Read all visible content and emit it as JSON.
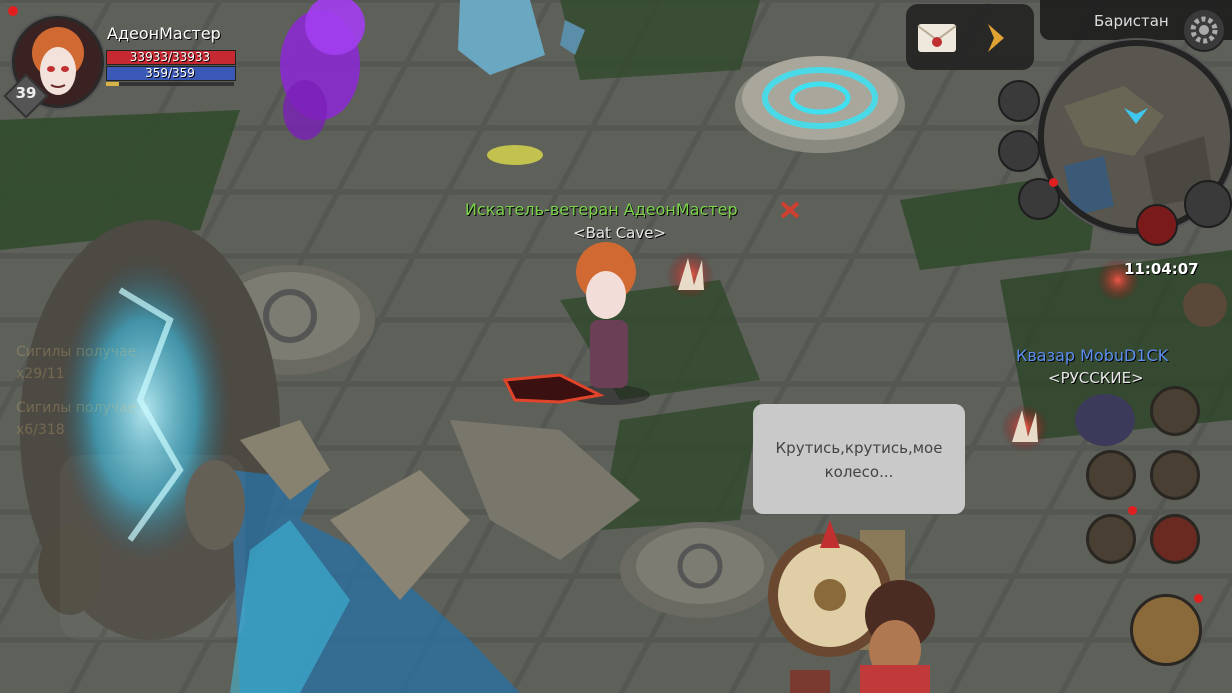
{
  "player": {
    "name": "АдеонМастер",
    "level": "39",
    "hp_text": "33933/33933",
    "mp_text": "359/359",
    "xp_fraction": 0.1
  },
  "location": {
    "name": "Баристан"
  },
  "clock": "11:04:07",
  "world": {
    "player_title": "Искатель-ветеран",
    "player_name": "АдеонМастер",
    "player_guild": "<Bat Cave>",
    "other_title": "Квазар",
    "other_name": "MobuD1CK",
    "other_guild": "<РУССКИЕ>"
  },
  "speech": {
    "text": "Крутись,крутись,мое колесо..."
  },
  "chat": {
    "line1": "Сигилы получае",
    "line1b": "x29/11",
    "line2": "Сигилы получае",
    "line2b": "x6/318"
  },
  "colors": {
    "hp": "#c62931",
    "mp": "#3a58b6",
    "player_name": "#7bd34a",
    "other_name": "#5c8ff0",
    "portal": "#4fd0f0"
  },
  "icons": {
    "mail": "envelope-icon",
    "expand": "chevron-right-icon",
    "settings": "gear-icon"
  }
}
